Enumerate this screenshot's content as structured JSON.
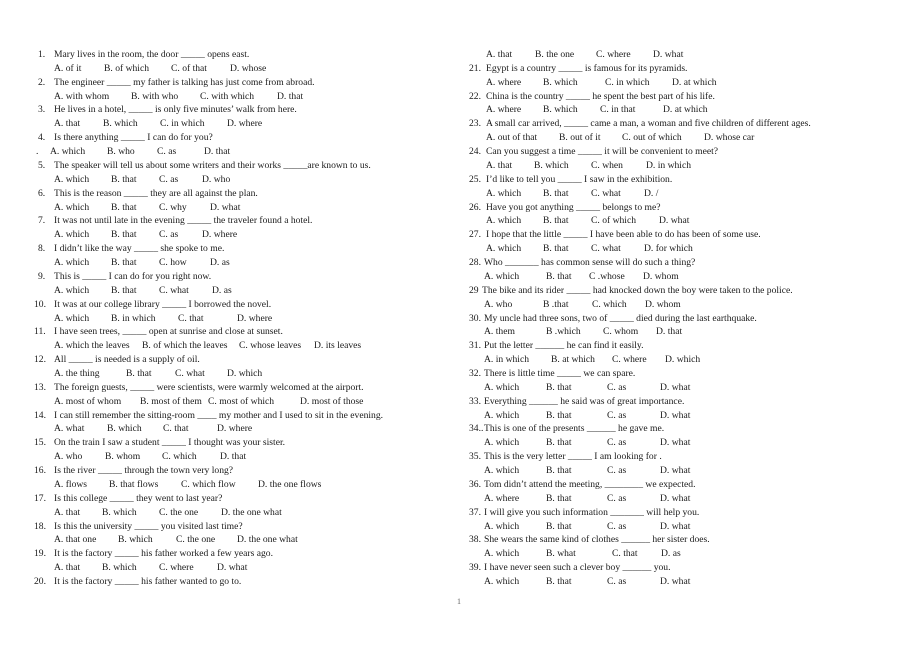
{
  "page_number": "1",
  "left_column": [
    {
      "num": "1.",
      "text": "Mary lives in the room, the door _____ opens east.",
      "options": [
        "A. of it",
        "B. of which",
        "C. of that",
        "D. whose"
      ]
    },
    {
      "num": "2.",
      "text": "The engineer _____ my father is talking has just come from abroad.",
      "options": [
        "A. with whom",
        "B. with who",
        "C. with which",
        "D. that"
      ]
    },
    {
      "num": "3.",
      "text": "He lives in a hotel, _____ is only five minutes’ walk from here.",
      "options": [
        "A. that",
        "B. which",
        "C. in which",
        "D. where"
      ]
    },
    {
      "num": "4.",
      "text": "Is there anything _____ I can do for you?",
      "options_prefix": ".",
      "options": [
        "A. which",
        "B. who",
        "C. as",
        "D. that"
      ]
    },
    {
      "num": "5.",
      "text": "The speaker will tell us about some writers and their works _____are known to us.",
      "options": [
        "A. which",
        "B. that",
        "C. as",
        "D. who"
      ]
    },
    {
      "num": "6.",
      "text": "This is the reason _____ they are all against the plan.",
      "options": [
        "A. which",
        "B. that",
        "C. why",
        "D. what"
      ]
    },
    {
      "num": "7.",
      "text": "It was not until late in the evening _____ the traveler found a hotel.",
      "options": [
        "A. which",
        "B. that",
        "C. as",
        "D. where"
      ]
    },
    {
      "num": "8.",
      "text": "I didn’t like the way _____ she spoke to me.",
      "options": [
        "A. which",
        "B. that",
        "C. how",
        "D. as"
      ]
    },
    {
      "num": "9.",
      "text": "This is _____ I can do for you right now.",
      "options": [
        "A. which",
        "B. that",
        "C. what",
        "D. as"
      ]
    },
    {
      "num": "10.",
      "text": "It was at our college library _____ I borrowed the novel.",
      "options": [
        "A. which",
        "B. in which",
        "C. that",
        "D. where"
      ]
    },
    {
      "num": "11.",
      "text": "I have seen trees, _____ open at sunrise and close at sunset.",
      "options": [
        "A. which the leaves",
        "B. of which the leaves",
        "C. whose leaves",
        "D. its leaves"
      ]
    },
    {
      "num": "12.",
      "text": "All _____ is needed is a supply of oil.",
      "options": [
        "A. the thing",
        "B. that",
        "C. what",
        "D. which"
      ]
    },
    {
      "num": "13.",
      "text": "The foreign guests, _____ were scientists, were warmly welcomed at the airport.",
      "options": [
        "A. most of whom",
        "B. most of them",
        "C. most of which",
        "D. most of those"
      ]
    },
    {
      "num": "14.",
      "text": "I can still remember the sitting-room ____ my mother and I used to sit in the evening.",
      "options": [
        "A. what",
        "B. which",
        "C. that",
        "D. where"
      ]
    },
    {
      "num": "15.",
      "text": "On the train I saw a student _____ I thought was your sister.",
      "options": [
        "A. who",
        "B. whom",
        "C. which",
        "D. that"
      ]
    },
    {
      "num": "16.",
      "text": "Is the river _____ through the town very long?",
      "options": [
        "A. flows",
        "B. that flows",
        "C. which flow",
        "D. the one flows"
      ]
    },
    {
      "num": "17.",
      "text": "Is this college _____ they went to last year?",
      "options": [
        "A. that",
        "B. which",
        "C. the one",
        "D. the one what"
      ]
    },
    {
      "num": "18.",
      "text": "Is this the university _____ you visited last time?",
      "options": [
        "A. that one",
        "B. which",
        "C. the one",
        "D. the one what"
      ]
    },
    {
      "num": "19.",
      "text": "It is the factory _____ his father worked a few years ago.",
      "options": [
        "A. that",
        "B. which",
        "C. where",
        "D. what"
      ]
    },
    {
      "num": "20.",
      "text": "It is the factory _____ his father wanted to go to.",
      "options": [
        "A. that",
        "B. the one",
        "C. where",
        "D. what"
      ]
    }
  ],
  "right_column": [
    {
      "num": "21.",
      "text": "Egypt is a country _____ is famous for its pyramids.",
      "options": [
        "A. where",
        "B. which",
        "C. in which",
        "D. at which"
      ]
    },
    {
      "num": "22.",
      "text": "China is the country _____ he spent the best part of his life.",
      "options": [
        "A. where",
        "B. which",
        "C. in that",
        "D. at which"
      ]
    },
    {
      "num": "23.",
      "text": "A small car arrived, _____ came a man, a woman and five children of different ages.",
      "options": [
        "A. out of that",
        "B. out of it",
        "C. out of which",
        "D. whose car"
      ]
    },
    {
      "num": "24.",
      "text": "Can you suggest a time _____ it will be convenient to meet?",
      "options": [
        "A. that",
        "B. which",
        "C. when",
        "D. in which"
      ]
    },
    {
      "num": "25.",
      "text": "I’d like to tell you _____ I saw in the exhibition.",
      "options": [
        "A. which",
        "B. that",
        "C. what",
        "D. /"
      ]
    },
    {
      "num": "26.",
      "text": "Have you got anything _____ belongs to me?",
      "options": [
        "A. which",
        "B. that",
        "C. of which",
        "D. what"
      ]
    },
    {
      "num": "27.",
      "text": "I hope that the little _____ I have been able to do has been of some use.",
      "options": [
        "A. which",
        "B. that",
        "C. what",
        "D. for which"
      ]
    },
    {
      "num": "28.",
      "text": "Who _______ has common sense will do such a thing?",
      "options": [
        "A. which",
        "B. that",
        "C .whose",
        "D. whom"
      ]
    },
    {
      "num": "29",
      "text": "The bike and its rider _____ had knocked down the boy were taken to the police.",
      "options": [
        "A. who",
        "B .that",
        "C. which",
        "D. whom"
      ]
    },
    {
      "num": "30.",
      "text": "My uncle had three sons, two of _____ died during the last earthquake.",
      "options": [
        "A. them",
        "B .which",
        "C. whom",
        "D. that"
      ]
    },
    {
      "num": "31.",
      "text": "Put the letter ______ he can find it easily.",
      "options": [
        "A. in which",
        "B. at which",
        "C. where",
        "D. which"
      ]
    },
    {
      "num": "32.",
      "text": "There is little time _____ we can spare.",
      "options": [
        "A. which",
        "B. that",
        "C. as",
        "D. what"
      ]
    },
    {
      "num": "33.",
      "text": "Everything ______ he said was of great importance.",
      "options": [
        "A. which",
        "B. that",
        "C. as",
        "D. what"
      ]
    },
    {
      "num": "34..",
      "text": "This is one of the presents ______ he gave me.",
      "options": [
        "A. which",
        "B. that",
        "C. as",
        "D. what"
      ]
    },
    {
      "num": "35.",
      "text": "This is the very letter _____ I am looking for .",
      "options": [
        "A. which",
        "B. that",
        "C. as",
        "D. what"
      ]
    },
    {
      "num": "36.",
      "text": "Tom didn’t attend the meeting, ________ we expected.",
      "options": [
        "A. where",
        "B. that",
        "C. as",
        "D. what"
      ]
    },
    {
      "num": "37.",
      "text": "I will give you such information _______ will help you.",
      "options": [
        "A. which",
        "B. that",
        "C. as",
        "D. what"
      ]
    },
    {
      "num": "38.",
      "text": "She wears the same kind of clothes ______ her sister does.",
      "options": [
        "A. which",
        "B. what",
        "C. that",
        "D. as"
      ]
    },
    {
      "num": "39.",
      "text": "I have never seen such a clever boy ______ you.",
      "options": [
        "A. which",
        "B. that",
        "C. as",
        "D. what"
      ]
    }
  ]
}
